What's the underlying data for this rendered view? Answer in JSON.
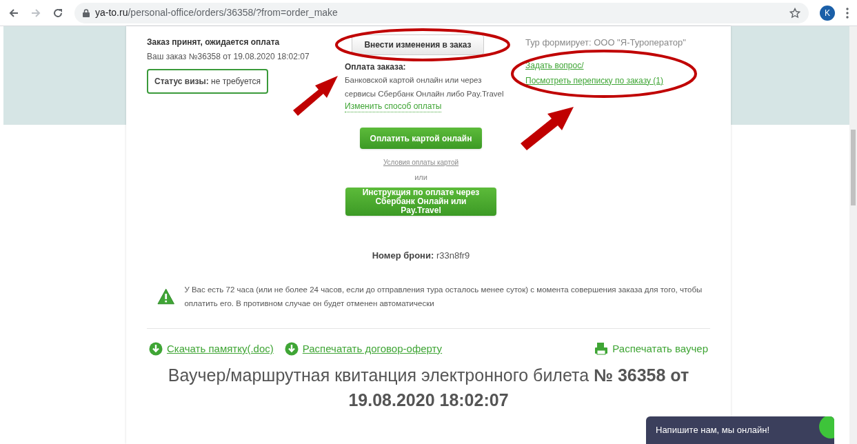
{
  "browser": {
    "url_host": "ya-to.ru",
    "url_path": "/personal-office/orders/36358/?from=order_make",
    "profile_initial": "K"
  },
  "order": {
    "status": "Заказ принят, ожидается оплата",
    "number": "Ваш заказ №36358 от 19.08.2020 18:02:07",
    "visa_label": "Статус визы:",
    "visa_value": "не требуется"
  },
  "payment": {
    "edit_button": "Внести изменения в заказ",
    "heading": "Оплата заказа:",
    "text": "Банковской картой онлайн или через сервисы Сбербанк Онлайн либо Pay.Travel",
    "change_link": "Изменить способ оплаты",
    "pay_button": "Оплатить картой онлайн",
    "terms_link": "Условия оплаты картой",
    "or": "или",
    "sber_button": "Инструкция по оплате через Сбербанк Онлайн или Pay.Travel"
  },
  "operator": {
    "text": "Тур формирует: ООО \"Я-Туроператор\"",
    "links": [
      "Задать вопрос/",
      "Посмотреть переписку по заказу (1)"
    ]
  },
  "booking": {
    "label": "Номер брони:",
    "value": "r33n8fr9"
  },
  "notice": "У Вас есть 72 часа (или не более 24 часов, если до отправления тура осталось менее суток) с момента совершения заказа для того, чтобы оплатить его. В противном случае он будет отменен автоматически",
  "documents": [
    {
      "kind": "download",
      "label": "Скачать памятку(.doc)"
    },
    {
      "kind": "download",
      "label": "Распечатать договор-оферту"
    },
    {
      "kind": "print",
      "label": "Распечатать ваучер"
    }
  ],
  "voucher_title": "Ваучер/маршрутная квитанция электронного билета **№ 36358 от 19.08.2020 18:02:07**",
  "chat": "Напишите нам, мы онлайн!"
}
